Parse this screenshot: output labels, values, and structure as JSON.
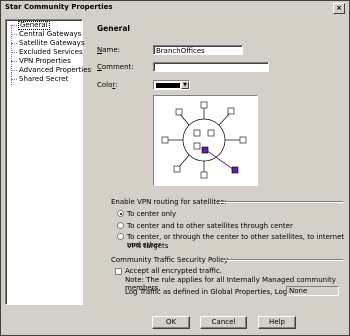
{
  "window": {
    "title": "Star Community Properties",
    "close_label": "×"
  },
  "tree": {
    "items": [
      {
        "label": "General",
        "selected": true
      },
      {
        "label": "Central Gateways"
      },
      {
        "label": "Satellite Gateways"
      },
      {
        "label": "Excluded Services"
      },
      {
        "label": "VPN Properties"
      },
      {
        "label": "Advanced Properties"
      },
      {
        "label": "Shared Secret"
      }
    ]
  },
  "general": {
    "heading": "General",
    "name_label": "Name:",
    "name_value": "BranchOffices",
    "comment_label": "Comment:",
    "comment_value": "",
    "color_label": "Color:",
    "color_value": "#000000"
  },
  "routing": {
    "heading": "Enable VPN routing for satellites:",
    "options": [
      {
        "label": "To center only",
        "checked": true
      },
      {
        "label": "To center and to other satellites through center",
        "checked": false
      },
      {
        "label": "To center, or through the center to other satellites, to internet and other",
        "label2": "VPN targets",
        "checked": false
      }
    ]
  },
  "policy": {
    "heading": "Community Traffic Security Policy",
    "accept_label": "Accept all encrypted traffic.",
    "accept_checked": false,
    "note": "Note: The rule applies for all Internally Managed community members.",
    "log_label": "Log Traffic as defined in Global Properties, Logging Tab:",
    "log_value": "None"
  },
  "buttons": {
    "ok": "OK",
    "cancel": "Cancel",
    "help": "Help"
  },
  "colors": {
    "accent": "#2020c0",
    "purple": "#6020a0"
  }
}
